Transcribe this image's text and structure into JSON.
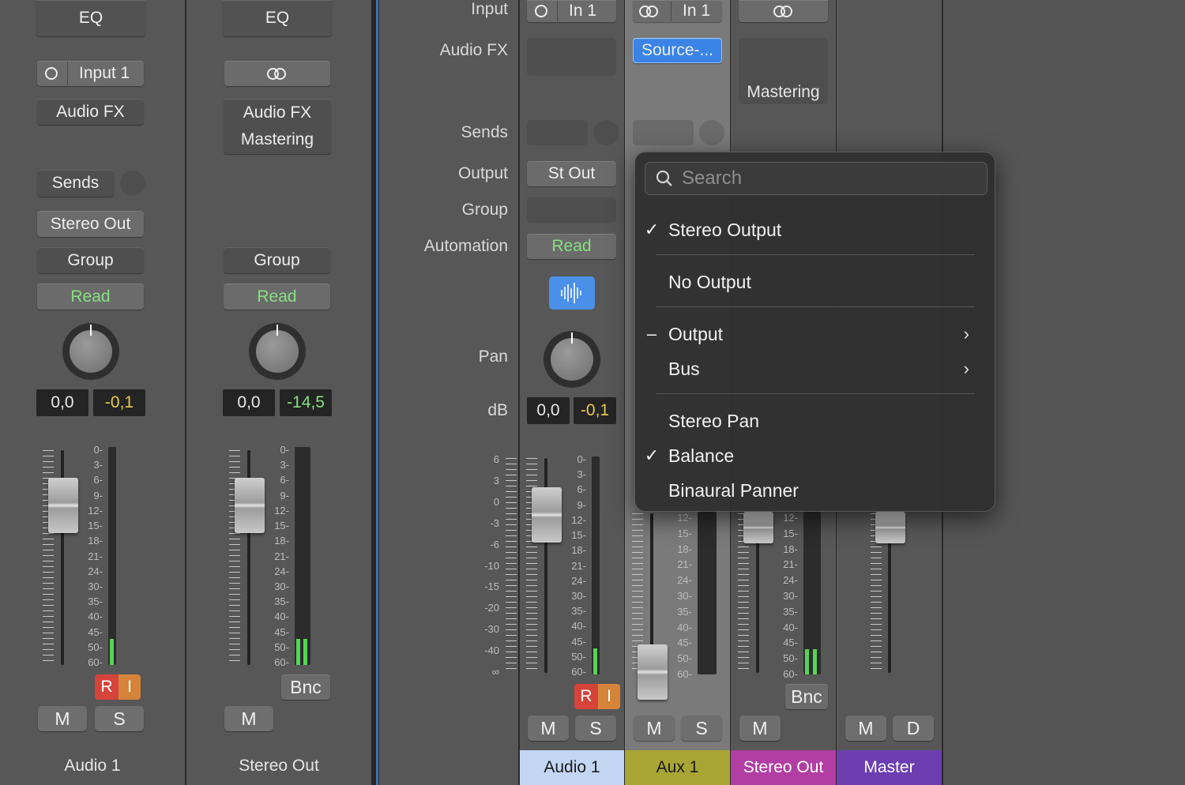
{
  "strip1": {
    "eq": "EQ",
    "input": "Input 1",
    "audio_fx": "Audio FX",
    "sends": "Sends",
    "output": "Stereo Out",
    "group": "Group",
    "automation": "Read",
    "pan_val": "0,0",
    "db_val": "-0,1",
    "rec": "R",
    "inp": "I",
    "mute": "M",
    "solo": "S",
    "name": "Audio 1",
    "meter_level": 0.12
  },
  "strip2": {
    "eq": "EQ",
    "audio_fx": "Audio FX",
    "fx_slot": "Mastering",
    "group": "Group",
    "automation": "Read",
    "pan_val": "0,0",
    "db_val": "-14,5",
    "bounce": "Bnc",
    "mute": "M",
    "name": "Stereo Out",
    "meter_level": 0.12
  },
  "labels": {
    "input": "Input",
    "audio_fx": "Audio FX",
    "sends": "Sends",
    "output": "Output",
    "group": "Group",
    "automation": "Automation",
    "pan": "Pan",
    "db": "dB"
  },
  "mixer": {
    "audio1": {
      "input": "In 1",
      "output": "St Out",
      "automation": "Read",
      "pan_val": "0,0",
      "db_val": "-0,1",
      "rec": "R",
      "inp": "I",
      "mute": "M",
      "solo": "S",
      "name": "Audio 1",
      "color": "#c3d7f5",
      "meter_level": 0.12
    },
    "aux1": {
      "input": "In 1",
      "fx": "Source-...",
      "mute": "M",
      "solo": "S",
      "name": "Aux 1",
      "color": "#a9a535"
    },
    "stereo_out": {
      "fx": "Mastering",
      "bounce": "Bnc",
      "mute": "M",
      "name": "Stereo Out",
      "color": "#b23ea3",
      "meter_level": 0.12
    },
    "master": {
      "mute": "M",
      "dim": "D",
      "name": "Master",
      "color": "#6c3eb2"
    }
  },
  "scale_meter": [
    "0",
    "3",
    "6",
    "9",
    "12",
    "15",
    "18",
    "21",
    "24",
    "30",
    "35",
    "40",
    "45",
    "50",
    "60"
  ],
  "scale_db": [
    "6",
    "3",
    "0",
    "-3",
    "-6",
    "-10",
    "-15",
    "-20",
    "-30",
    "-40",
    "∞"
  ],
  "menu": {
    "search_placeholder": "Search",
    "items": [
      {
        "label": "Stereo Output",
        "check": "✓"
      },
      {
        "label": "No Output",
        "check": ""
      },
      {
        "label": "Output",
        "check": "–",
        "submenu": "›"
      },
      {
        "label": "Bus",
        "check": "",
        "submenu": "›"
      },
      {
        "label": "Stereo Pan",
        "check": ""
      },
      {
        "label": "Balance",
        "check": "✓"
      },
      {
        "label": "Binaural Panner",
        "check": ""
      }
    ]
  }
}
